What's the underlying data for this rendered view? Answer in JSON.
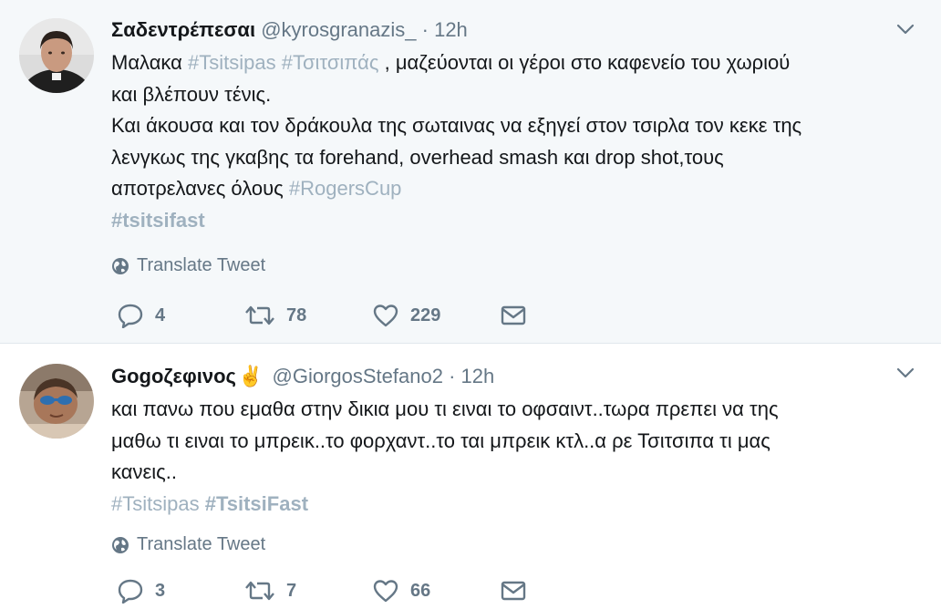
{
  "tweets": [
    {
      "display_name": "Σαδεντρέπεσαι",
      "handle": "@kyrosgranazis_",
      "dot": "·",
      "time": "12h",
      "lines": [
        [
          {
            "t": "Μαλακα "
          },
          {
            "t": "#Tsitsipas",
            "h": true
          },
          {
            "t": " "
          },
          {
            "t": "#Τσιτσιπάς",
            "h": true
          },
          {
            "t": " ,  μαζεύονται οι γέροι στο καφενείο του χωριού"
          }
        ],
        [
          {
            "t": "και βλέπουν τένις."
          }
        ],
        [
          {
            "t": "Και άκουσα και τον δράκουλα της σωταινας να εξηγεί στον τσιρλα τον κεκε της"
          }
        ],
        [
          {
            "t": "λενγκως της γκαβης τα forehand, overhead smash και drop shot,τους"
          }
        ],
        [
          {
            "t": "αποτρελανες όλους "
          },
          {
            "t": "#RogersCup",
            "h": true
          }
        ],
        [
          {
            "t": "#tsitsifast",
            "h": true,
            "b": true
          }
        ]
      ],
      "translate_label": "Translate Tweet",
      "replies": "4",
      "retweets": "78",
      "likes": "229"
    },
    {
      "display_name": "Gogοζεφινος",
      "emoji": "✌️",
      "handle": "@GiorgosStefano2",
      "dot": "·",
      "time": "12h",
      "lines": [
        [
          {
            "t": "και πανω που εμαθα στην δικια μου τι ειναι το οφσαιντ..τωρα πρεπει να της"
          }
        ],
        [
          {
            "t": "μαθω τι ειναι το μπρεικ..το φορχαντ..το ται μπρεικ κτλ..α ρε Τσιτσιπα τι μας"
          }
        ],
        [
          {
            "t": "κανεις.."
          }
        ],
        [
          {
            "t": "#Tsitsipas",
            "h": true
          },
          {
            "t": " "
          },
          {
            "t": "#TsitsiFast",
            "h": true,
            "b": true
          }
        ]
      ],
      "translate_label": "Translate Tweet",
      "replies": "3",
      "retweets": "7",
      "likes": "66"
    }
  ],
  "colors": {
    "hashtag": "#9fb1bf",
    "meta": "#657786",
    "highlight_bg": "#f5f8fa"
  },
  "icons": [
    "avatar",
    "chevron-down-icon",
    "globe-icon",
    "reply-icon",
    "retweet-icon",
    "like-icon",
    "dm-icon"
  ]
}
